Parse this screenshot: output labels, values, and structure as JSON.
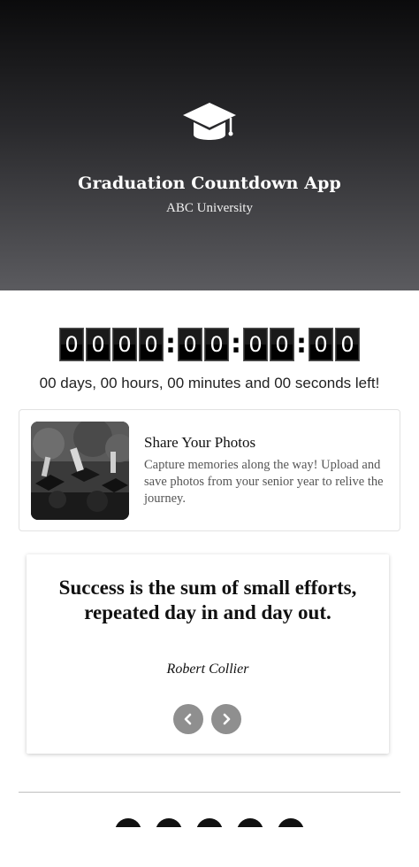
{
  "hero": {
    "title": "Graduation Countdown App",
    "subtitle": "ABC University",
    "icon": "graduation-cap-icon",
    "gradient": [
      "#0b0b0c",
      "#5b5b5f"
    ]
  },
  "countdown": {
    "days": [
      "0",
      "0",
      "0",
      "0"
    ],
    "hours": [
      "0",
      "0"
    ],
    "minutes": [
      "0",
      "0"
    ],
    "seconds": [
      "0",
      "0"
    ],
    "separator": ":",
    "summary": "00 days, 00 hours, 00 minutes and 00 seconds left!"
  },
  "photo_card": {
    "title": "Share Your Photos",
    "description": "Capture memories along the way! Upload and save photos from your senior year to relive the journey."
  },
  "quote": {
    "text": "Success is the sum of small efforts, repeated day in and day out.",
    "author": "Robert Collier",
    "prev_icon": "chevron-left-icon",
    "next_icon": "chevron-right-icon"
  },
  "footer": {
    "social_icons": [
      "social-icon",
      "social-icon",
      "social-icon",
      "social-icon",
      "social-icon"
    ]
  }
}
